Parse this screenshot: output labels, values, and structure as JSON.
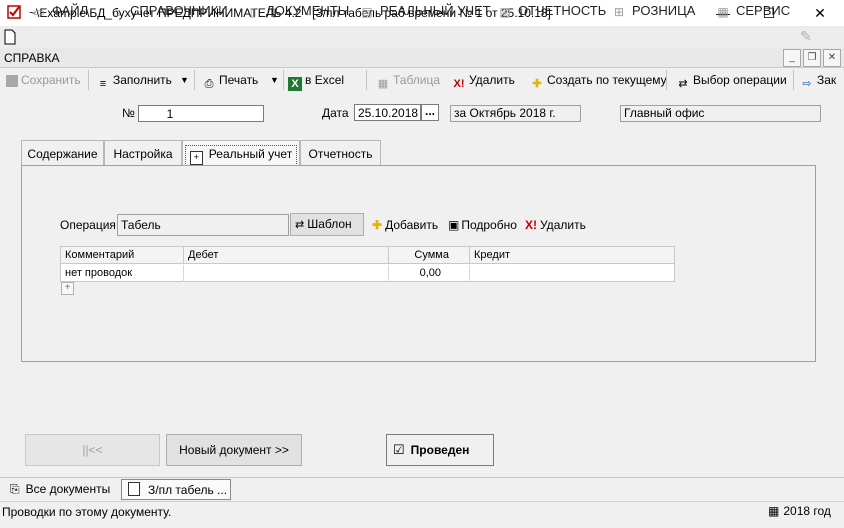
{
  "window": {
    "title": "~\\Example\\БД_бухучет  ПРЕДПРИНИМАТЕЛЬ 4.2 - [З/пл табель раб времени № 1 от 25.10.18]",
    "minimize": "—",
    "maximize": "☐",
    "close": "✕"
  },
  "menu": {
    "items": [
      {
        "label": "ФАЙЛ",
        "icon": "folder-icon"
      },
      {
        "label": "СПРАВОЧНИКИ",
        "icon": "house-icon"
      },
      {
        "label": "ДОКУМЕНТЫ",
        "icon": "document-icon"
      },
      {
        "label": "РЕАЛЬНЫЙ УЧЕТ",
        "icon": "ledger-icon"
      },
      {
        "label": "ОТЧЕТНОСТЬ",
        "icon": "report-icon"
      },
      {
        "label": "РОЗНИЦА",
        "icon": "cart-icon"
      },
      {
        "label": "СЕРВИС",
        "icon": "service-icon"
      }
    ],
    "help": "СПРАВКА"
  },
  "toolbar": {
    "save": "Сохранить",
    "fill": "Заполнить",
    "print": "Печать",
    "excel": "в Excel",
    "table": "Таблица",
    "delete": "Удалить",
    "create_from": "Создать по текущему",
    "select_op": "Выбор операции",
    "close_partial": "Зак"
  },
  "header": {
    "number_label": "№",
    "number_value": "1",
    "date_label": "Дата",
    "date_value": "25.10.2018",
    "date_btn": "...",
    "period": "за Октябрь 2018 г.",
    "office": "Главный офис"
  },
  "tabs": [
    {
      "label": "Содержание"
    },
    {
      "label": "Настройка"
    },
    {
      "label": "Реальный учет",
      "active": true
    },
    {
      "label": "Отчетность"
    }
  ],
  "operation": {
    "label": "Операция",
    "value": "Табель",
    "template_btn": "Шаблон",
    "add_btn": "Добавить",
    "details_btn": "Подробно",
    "delete_btn": "Удалить"
  },
  "grid": {
    "columns": [
      "Комментарий",
      "Дебет",
      "Сумма",
      "Кредит"
    ],
    "rows": [
      {
        "comment": "нет проводок",
        "debit": "",
        "sum": "0,00",
        "credit": ""
      }
    ],
    "expand": "+"
  },
  "footer": {
    "first_btn": "||<<",
    "new_doc_btn": "Новый документ >>",
    "posted_label": "Проведен",
    "posted_checked": "☑"
  },
  "taskbar": {
    "all_docs": "Все документы",
    "current": "З/пл табель ..."
  },
  "status": {
    "text": "Проводки по этому документу.",
    "year": "2018 год"
  },
  "colors": {
    "accent_red": "#c00000",
    "excel_green": "#1d7a34",
    "plus_yellow": "#e3b400"
  }
}
